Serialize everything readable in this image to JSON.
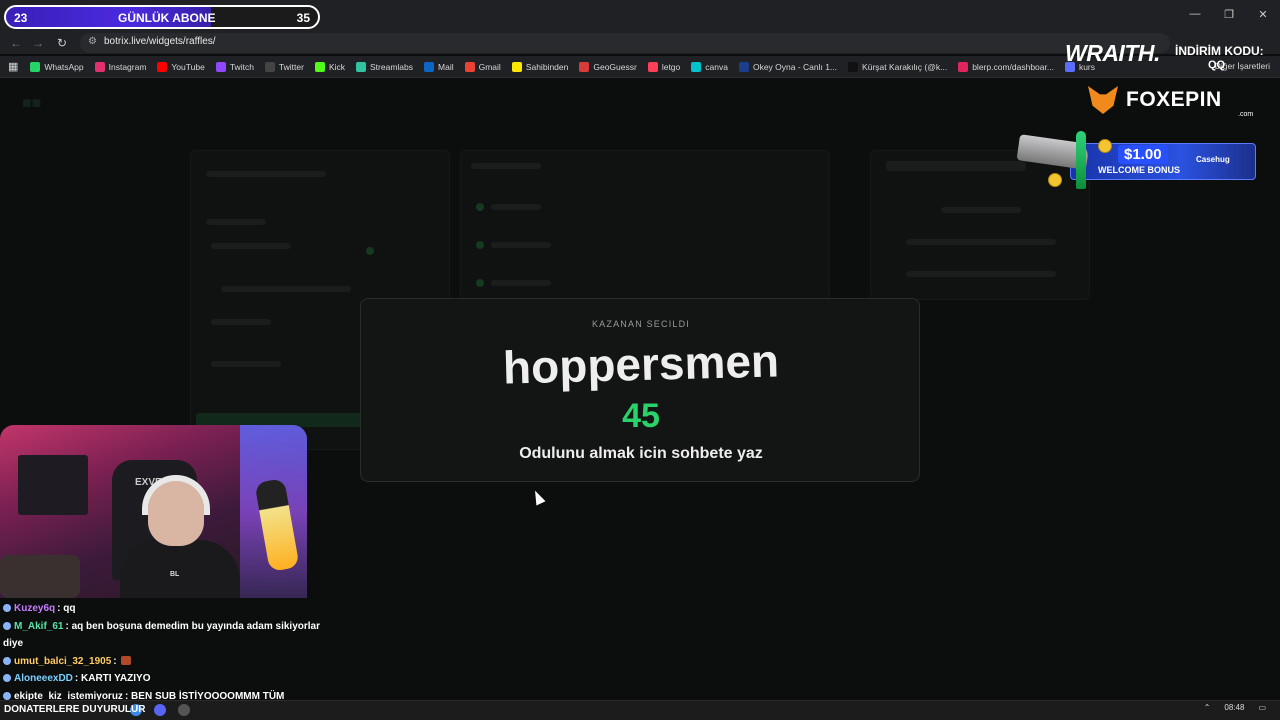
{
  "browser": {
    "url": "botrix.live/widgets/raffles/",
    "bookmarks": [
      {
        "label": "WhatsApp",
        "color": "#25d366"
      },
      {
        "label": "Instagram",
        "color": "#e1306c"
      },
      {
        "label": "YouTube",
        "color": "#ff0000"
      },
      {
        "label": "Twitch",
        "color": "#9146ff"
      },
      {
        "label": "Twitter",
        "color": "#444444"
      },
      {
        "label": "Kick",
        "color": "#53fc18"
      },
      {
        "label": "Streamlabs",
        "color": "#31c3a2"
      },
      {
        "label": "Mail",
        "color": "#0a66c2"
      },
      {
        "label": "Gmail",
        "color": "#ea4335"
      },
      {
        "label": "Sahibinden",
        "color": "#ffe800"
      },
      {
        "label": "GeoGuessr",
        "color": "#d93a3a"
      },
      {
        "label": "letgo",
        "color": "#ff3f55"
      },
      {
        "label": "canva",
        "color": "#00c4cc"
      },
      {
        "label": "Okey Oyna - Canlı 1...",
        "color": "#1a3e8c"
      },
      {
        "label": "Kürşat Karakılıç (@k...",
        "color": "#111111"
      },
      {
        "label": "blerp.com/dashboar...",
        "color": "#e0245e"
      },
      {
        "label": "kurs",
        "color": "#5b6cff"
      }
    ],
    "bookmarks_right": "Diğer İşaretleri"
  },
  "sub_counter": {
    "current": "23",
    "label": "GÜNLÜK ABONE",
    "goal": "35",
    "progress": 0.657
  },
  "sponsors": {
    "wraith_brand": "WRAITH.",
    "code_label": "İNDİRİM KODU:",
    "code_value": "QQ",
    "foxepin_brand": "FOXEPIN",
    "foxepin_tld": ".com",
    "case_price": "$1.00",
    "case_bonus": "WELCOME BONUS",
    "case_logo": "Casehug"
  },
  "modal": {
    "label": "KAZANAN SECILDI",
    "winner": "hoppersmen",
    "number": "45",
    "message": "Odulunu almak icin sohbete yaz"
  },
  "webcam": {
    "chair_text": "EXVE",
    "shirt_text": "BL"
  },
  "chat": [
    {
      "user": "Kuzey6q",
      "color": "#c77dff",
      "message": ": qq",
      "emote": false
    },
    {
      "user": "M_Akif_61",
      "color": "#58e3a8",
      "message": ": aq ben boşuna demedim bu yayında adam sikiyorlar diye",
      "emote": false
    },
    {
      "user": "umut_balci_32_1905",
      "color": "#ffcc66",
      "message": ":",
      "emote": true
    },
    {
      "user": "AloneeexDD",
      "color": "#7ad0ff",
      "message": ": KARTI YAZIYO",
      "emote": false
    },
    {
      "user": "ekipte_kiz_istemiyoruz",
      "color": "#ffffff",
      "message": ": BEN SUB İSTİYOOOOMMM TÜM",
      "emote": false
    }
  ],
  "taskbar": {
    "announcement": "DONATERLERE DUYURULUR",
    "time": "08:48"
  }
}
